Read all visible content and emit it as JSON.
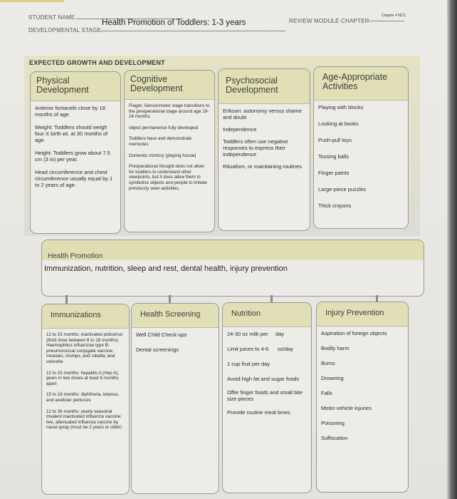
{
  "header": {
    "student_name_label": "STUDENT NAME",
    "student_name_value": "",
    "developmental_stage_label": "DEVELOPMENTAL STAGE",
    "developmental_stage_value": "Health Promotion of Toddlers: 1-3 years",
    "review_module_label": "REVIEW MODULE CHAPTER",
    "review_module_value": "Chapter 4 NCC"
  },
  "growth": {
    "title": "EXPECTED GROWTH AND DEVELOPMENT",
    "physical": {
      "title": "Physical Development",
      "items": [
        "Anterior fontanels close by 18 months of age.",
        "Weight: Toddlers should weigh four X birth wt. at 30 months of age.",
        "Height: Toddlers grow about 7.5 cm (3 in) per year.",
        "Head circumference and chest circumference usually equal by 1 to 2 years of age."
      ]
    },
    "cognitive": {
      "title": "Cognitive Development",
      "items": [
        "Piaget: Sensorimotor stage transitions to the preoperational stage around age 19-24 months.",
        "object permanence fully developed",
        "Toddlers have and demonstrate memories",
        "Domestic mimicry (playing house)",
        "Preoperational thought does not allow for toddlers to understand other viewpoints, but it does allow them to symbolize objects and people to imitate previously seen activities."
      ]
    },
    "psychosocial": {
      "title": "Psychosocial Development",
      "items": [
        "Erikson: autonomy versus shame and doubt",
        "Independence",
        "Toddlers often use negative responses to express their independence",
        "Ritualism, or maintaining routines"
      ]
    },
    "activities": {
      "title": "Age-Appropriate Activities",
      "items": [
        "Playing with blocks",
        "Looking at books",
        "Push-pull toys",
        "Tossing balls",
        "Finger paints",
        "Large-piece puzzles",
        "Thick crayons"
      ]
    }
  },
  "health_promotion": {
    "title": "Health Promotion",
    "summary": "Immunization, nutrition, sleep and rest, dental health, injury prevention",
    "immunizations": {
      "title": "Immunizations",
      "items": [
        "12 to 15 months: inactivated poliovirus (third dose between 6 to 18 months) Haemophilus influenzae type B; pneumococcal conjugate vaccine; measles, mumps, and rubella; and varicella",
        "12 to 23 months: hepatitis A (Hep A), given in two doses at least 6 months apart",
        "15 to 18 months: diphtheria, tetanus, and acellular pertussis",
        "12 to 36 months: yearly seasonal trivalent inactivated influenza vaccine; live, attenuated influenza vaccine by nasal spray (must be 2 years or older)"
      ]
    },
    "screening": {
      "title": "Health Screening",
      "items": [
        "Well Child  Check-ups",
        "Dental screenings"
      ]
    },
    "nutrition": {
      "title": "Nutrition",
      "items": [
        "24-30 oz milk per     day",
        "Limit juices to 4-6      oz/day",
        "1 cup fruit per day",
        "Avoid high fat and sugar foods",
        "Offer finger foods and small bite size pieces",
        "Provide routine meal times"
      ]
    },
    "injury": {
      "title": "Injury Prevention",
      "items": [
        "Aspiration of foreign objects",
        "Bodily harm",
        "Burns",
        "Drowning",
        "Falls",
        "Motor-vehicle injuries",
        "Poisoning",
        "Suffocation"
      ]
    }
  }
}
